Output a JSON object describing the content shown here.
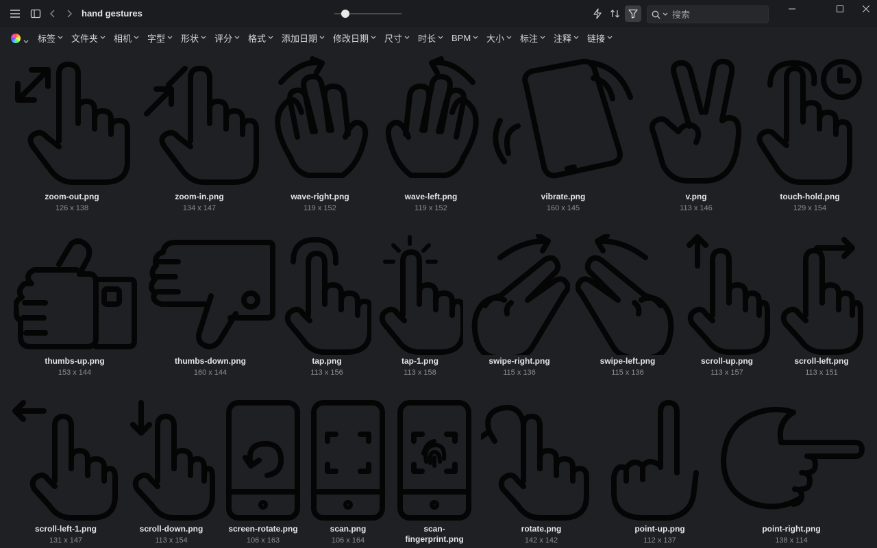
{
  "window": {
    "title": "hand gestures"
  },
  "toolbar": {
    "slider_value": 0.12,
    "search": {
      "placeholder": "搜索",
      "value": ""
    },
    "icons": [
      "menu-icon",
      "sidebar-toggle-icon",
      "back-icon",
      "forward-icon",
      "lightning-icon",
      "sort-icon",
      "filter-icon",
      "search-icon"
    ]
  },
  "filters": [
    "标签",
    "文件夹",
    "相机",
    "字型",
    "形状",
    "评分",
    "格式",
    "添加日期",
    "修改日期",
    "尺寸",
    "时长",
    "BPM",
    "大小",
    "标注",
    "注释",
    "链接"
  ],
  "files": [
    {
      "name": "zoom-out.png",
      "dims": "126 x 138"
    },
    {
      "name": "zoom-in.png",
      "dims": "134 x 147"
    },
    {
      "name": "wave-right.png",
      "dims": "119 x 152"
    },
    {
      "name": "wave-left.png",
      "dims": "119 x 152"
    },
    {
      "name": "vibrate.png",
      "dims": "160 x 145"
    },
    {
      "name": "v.png",
      "dims": "113 x 146"
    },
    {
      "name": "touch-hold.png",
      "dims": "129 x 154"
    },
    {
      "name": "thumbs-up.png",
      "dims": "153 x 144"
    },
    {
      "name": "thumbs-down.png",
      "dims": "160 x 144"
    },
    {
      "name": "tap.png",
      "dims": "113 x 156"
    },
    {
      "name": "tap-1.png",
      "dims": "113 x 158"
    },
    {
      "name": "swipe-right.png",
      "dims": "115 x 136"
    },
    {
      "name": "swipe-left.png",
      "dims": "115 x 136"
    },
    {
      "name": "scroll-up.png",
      "dims": "113 x 157"
    },
    {
      "name": "scroll-left.png",
      "dims": "113 x 151"
    },
    {
      "name": "scroll-left-1.png",
      "dims": "131 x 147"
    },
    {
      "name": "scroll-down.png",
      "dims": "113 x 154"
    },
    {
      "name": "screen-rotate.png",
      "dims": "106 x 163"
    },
    {
      "name": "scan.png",
      "dims": "106 x 164"
    },
    {
      "name": "scan-fingerprint.png",
      "dims": ""
    },
    {
      "name": "rotate.png",
      "dims": "142 x 142"
    },
    {
      "name": "point-up.png",
      "dims": "112 x 137"
    },
    {
      "name": "point-right.png",
      "dims": "138 x 114"
    }
  ],
  "colors": {
    "background": "#1f2023",
    "titlebar": "#1b1c1f",
    "icon_stroke": "#050505"
  }
}
